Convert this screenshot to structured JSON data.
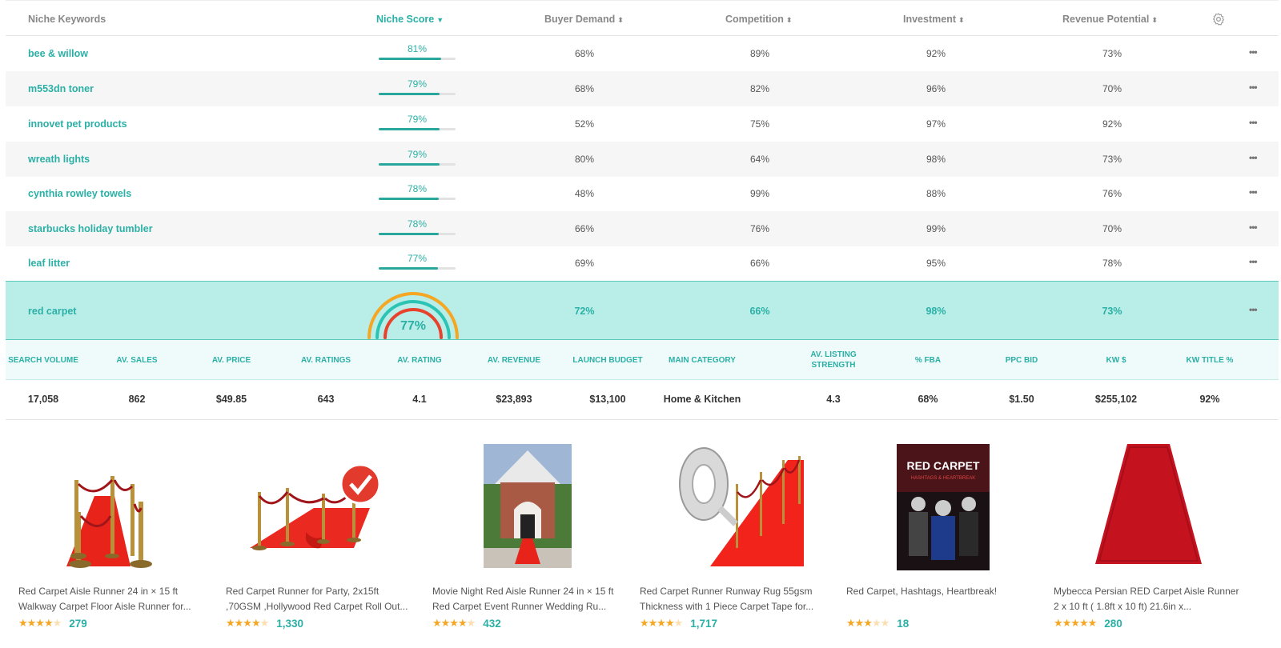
{
  "header": {
    "keywords": "Niche Keywords",
    "niche_score": "Niche Score",
    "buyer_demand": "Buyer Demand",
    "competition": "Competition",
    "investment": "Investment",
    "revenue_potential": "Revenue Potential",
    "settings_icon": "gear-icon",
    "sort_active_icon": "caret-down-icon",
    "sort_icon": "sort-icon"
  },
  "rows": [
    {
      "keyword": "bee & willow",
      "score": "81%",
      "score_value": 0.81,
      "buyer_demand": "68%",
      "competition": "89%",
      "investment": "92%",
      "revenue": "73%",
      "more": "•••"
    },
    {
      "keyword": "m553dn toner",
      "score": "79%",
      "score_value": 0.79,
      "buyer_demand": "68%",
      "competition": "82%",
      "investment": "96%",
      "revenue": "70%",
      "more": "•••"
    },
    {
      "keyword": "innovet pet products",
      "score": "79%",
      "score_value": 0.79,
      "buyer_demand": "52%",
      "competition": "75%",
      "investment": "97%",
      "revenue": "92%",
      "more": "•••"
    },
    {
      "keyword": "wreath lights",
      "score": "79%",
      "score_value": 0.79,
      "buyer_demand": "80%",
      "competition": "64%",
      "investment": "98%",
      "revenue": "73%",
      "more": "•••"
    },
    {
      "keyword": "cynthia rowley towels",
      "score": "78%",
      "score_value": 0.78,
      "buyer_demand": "48%",
      "competition": "99%",
      "investment": "88%",
      "revenue": "76%",
      "more": "•••"
    },
    {
      "keyword": "starbucks holiday tumbler",
      "score": "78%",
      "score_value": 0.78,
      "buyer_demand": "66%",
      "competition": "76%",
      "investment": "99%",
      "revenue": "70%",
      "more": "•••"
    },
    {
      "keyword": "leaf litter",
      "score": "77%",
      "score_value": 0.77,
      "buyer_demand": "69%",
      "competition": "66%",
      "investment": "95%",
      "revenue": "78%",
      "more": "•••"
    }
  ],
  "selected": {
    "keyword": "red carpet",
    "score": "77%",
    "score_value": 0.77,
    "buyer_demand": "72%",
    "competition": "66%",
    "investment": "98%",
    "revenue": "73%",
    "more": "•••"
  },
  "metrics": [
    {
      "label": "SEARCH VOLUME",
      "value": "17,058"
    },
    {
      "label": "AV. SALES",
      "value": "862"
    },
    {
      "label": "AV. PRICE",
      "value": "$49.85"
    },
    {
      "label": "AV. RATINGS",
      "value": "643"
    },
    {
      "label": "AV. RATING",
      "value": "4.1"
    },
    {
      "label": "AV. REVENUE",
      "value": "$23,893"
    },
    {
      "label": "LAUNCH BUDGET",
      "value": "$13,100"
    },
    {
      "label": "MAIN CATEGORY",
      "value": "Home & Kitchen"
    },
    {
      "label": "AV. LISTING STRENGTH",
      "value": "4.3"
    },
    {
      "label": "% FBA",
      "value": "68%"
    },
    {
      "label": "PPC BID",
      "value": "$1.50"
    },
    {
      "label": "KW $",
      "value": "$255,102"
    },
    {
      "label": "KW TITLE %",
      "value": "92%"
    }
  ],
  "products": [
    {
      "title": "Red Carpet Aisle Runner 24 in × 15 ft Walkway Carpet Floor Aisle Runner for...",
      "stars": 4,
      "reviews": "279",
      "image": "red-carpet-stanchions-image"
    },
    {
      "title": "Red Carpet Runner for Party, 2x15ft ,70GSM ,Hollywood Red Carpet Roll Out...",
      "stars": 4,
      "reviews": "1,330",
      "image": "red-carpet-runner-badge-image"
    },
    {
      "title": "Movie Night Red Aisle Runner 24 in × 15 ft Red Carpet Event Runner Wedding Ru...",
      "stars": 4,
      "reviews": "432",
      "image": "house-entrance-red-carpet-image"
    },
    {
      "title": "Red Carpet Runner Runway Rug 55gsm Thickness with 1 Piece Carpet Tape for...",
      "stars": 4,
      "reviews": "1,717",
      "image": "red-carpet-tape-image"
    },
    {
      "title": "Red Carpet, Hashtags, Heartbreak!",
      "stars": 3,
      "reviews": "18",
      "image": "movie-poster-image"
    },
    {
      "title": "Mybecca Persian RED Carpet Aisle Runner 2 x 10 ft ( 1.8ft x 10 ft) 21.6in x...",
      "stars": 4.5,
      "reviews": "280",
      "image": "persian-red-carpet-image"
    }
  ],
  "colors": {
    "accent": "#2bb0a6",
    "selected_row": "#b8ede8",
    "star": "#f5a623",
    "gauge_orange": "#f5a623",
    "gauge_teal": "#2bc4b4",
    "gauge_red": "#e8412c"
  }
}
